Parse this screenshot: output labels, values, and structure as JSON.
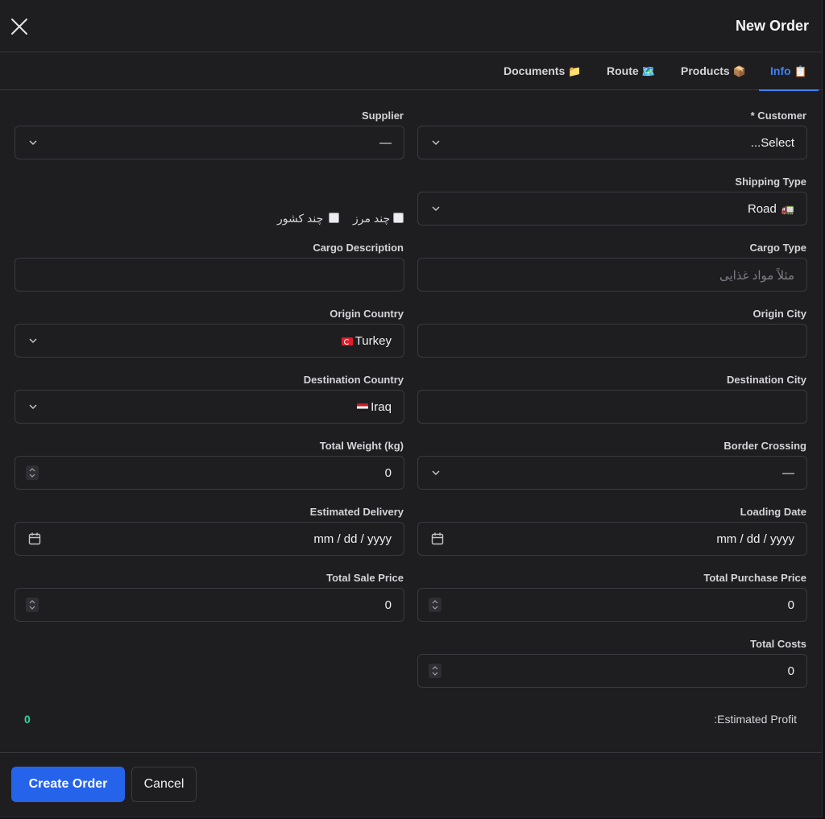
{
  "header": {
    "title": "New Order"
  },
  "tabs": {
    "documents": {
      "label": "Documents",
      "icon": "📁"
    },
    "route": {
      "label": "Route",
      "icon": "🗺️"
    },
    "products": {
      "label": "Products",
      "icon": "📦"
    },
    "info": {
      "label": "Info",
      "icon": "📋"
    }
  },
  "form": {
    "customer": {
      "label": "* Customer",
      "value": "...Select"
    },
    "supplier": {
      "label": "Supplier",
      "value": "—"
    },
    "shipping_type": {
      "label": "Shipping Type",
      "value": "Road",
      "icon": "🚛"
    },
    "multi_border": {
      "label": "چند مرز",
      "checked": false
    },
    "multi_country": {
      "label": "چند کشور",
      "checked": false
    },
    "cargo_type": {
      "label": "Cargo Type",
      "value": "",
      "placeholder": "مثلاً مواد غذایی"
    },
    "cargo_description": {
      "label": "Cargo Description",
      "value": ""
    },
    "origin_city": {
      "label": "Origin City",
      "value": ""
    },
    "origin_country": {
      "label": "Origin Country",
      "value": "Turkey",
      "flag": "tr"
    },
    "destination_city": {
      "label": "Destination City",
      "value": ""
    },
    "destination_country": {
      "label": "Destination Country",
      "value": "Iraq",
      "flag": "iq"
    },
    "border_crossing": {
      "label": "Border Crossing",
      "value": "—"
    },
    "total_weight": {
      "label": "Total Weight (kg)",
      "value": "0"
    },
    "loading_date": {
      "label": "Loading Date",
      "value": "mm / dd / yyyy"
    },
    "estimated_delivery": {
      "label": "Estimated Delivery",
      "value": "mm / dd / yyyy"
    },
    "total_purchase_price": {
      "label": "Total Purchase Price",
      "value": "0"
    },
    "total_sale_price": {
      "label": "Total Sale Price",
      "value": "0"
    },
    "total_costs": {
      "label": "Total Costs",
      "value": "0"
    }
  },
  "summary": {
    "estimated_profit_label": ":Estimated Profit",
    "estimated_profit_value": "0"
  },
  "footer": {
    "create_label": "Create Order",
    "cancel_label": "Cancel"
  },
  "colors": {
    "accent": "#2563eb",
    "active_tab": "#3b82f6",
    "profit": "#34d399",
    "background": "#1e1e21"
  }
}
